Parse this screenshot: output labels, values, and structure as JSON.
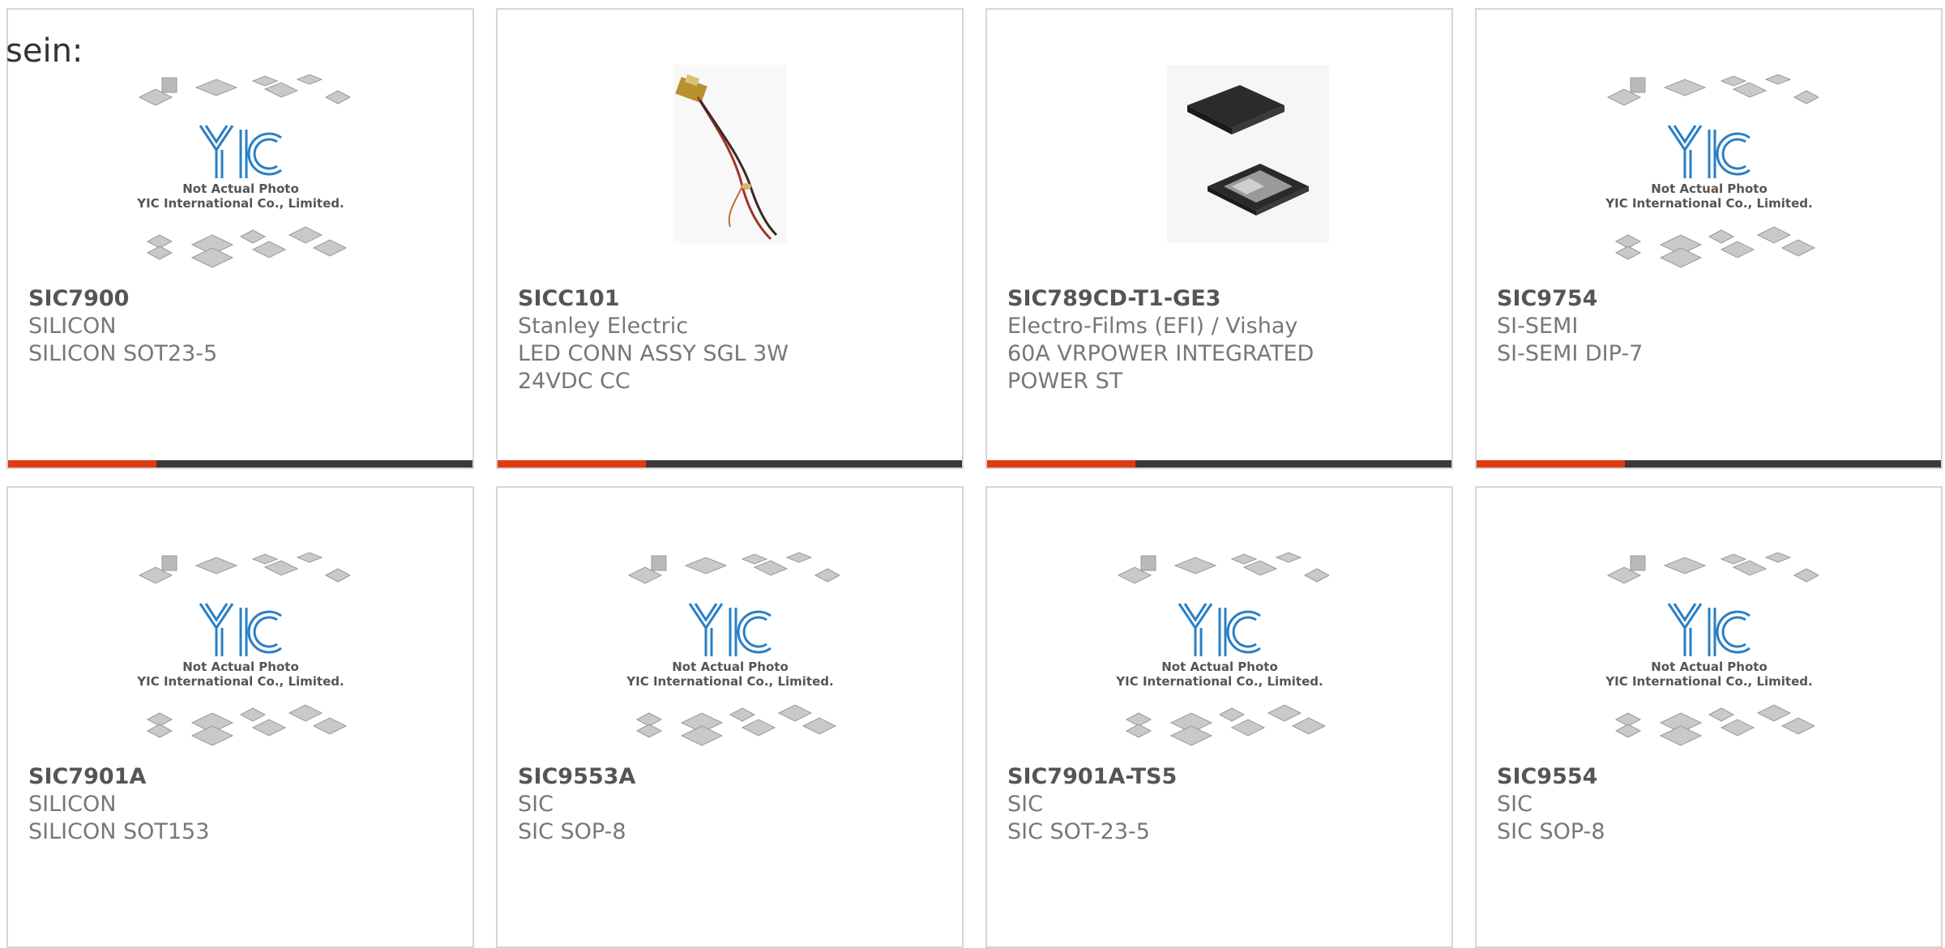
{
  "intro_text": "sein:",
  "placeholder": {
    "caption_line1": "Not Actual Photo",
    "caption_line2": "YIC International Co., Limited.",
    "logo_text": "YIC"
  },
  "colors": {
    "accent": "#e23a12",
    "bar_dark": "#3a3a3a",
    "logo_blue": "#2a7fc4",
    "border": "#d6d6d6"
  },
  "products": [
    {
      "part": "SIC7900",
      "manufacturer": "SILICON",
      "description": "SILICON SOT23-5",
      "image": "placeholder-photo",
      "progress": 0.32
    },
    {
      "part": "SICC101",
      "manufacturer": "Stanley Electric",
      "description": "LED CONN ASSY SGL 3W 24VDC CC",
      "image": "led-cable-photo",
      "progress": 0.32
    },
    {
      "part": "SIC789CD-T1-GE3",
      "manufacturer": "Electro-Films (EFI) / Vishay",
      "description": "60A VRPOWER INTEGRATED POWER ST",
      "image": "qfn-chip-photo",
      "progress": 0.32
    },
    {
      "part": "SIC9754",
      "manufacturer": "SI-SEMI",
      "description": "SI-SEMI DIP-7",
      "image": "placeholder-photo",
      "progress": 0.32
    },
    {
      "part": "SIC7901A",
      "manufacturer": "SILICON",
      "description": "SILICON SOT153",
      "image": "placeholder-photo",
      "progress": 0
    },
    {
      "part": "SIC9553A",
      "manufacturer": "SIC",
      "description": "SIC SOP-8",
      "image": "placeholder-photo",
      "progress": 0
    },
    {
      "part": "SIC7901A-TS5",
      "manufacturer": "SIC",
      "description": "SIC SOT-23-5",
      "image": "placeholder-photo",
      "progress": 0
    },
    {
      "part": "SIC9554",
      "manufacturer": "SIC",
      "description": "SIC SOP-8",
      "image": "placeholder-photo",
      "progress": 0
    }
  ]
}
